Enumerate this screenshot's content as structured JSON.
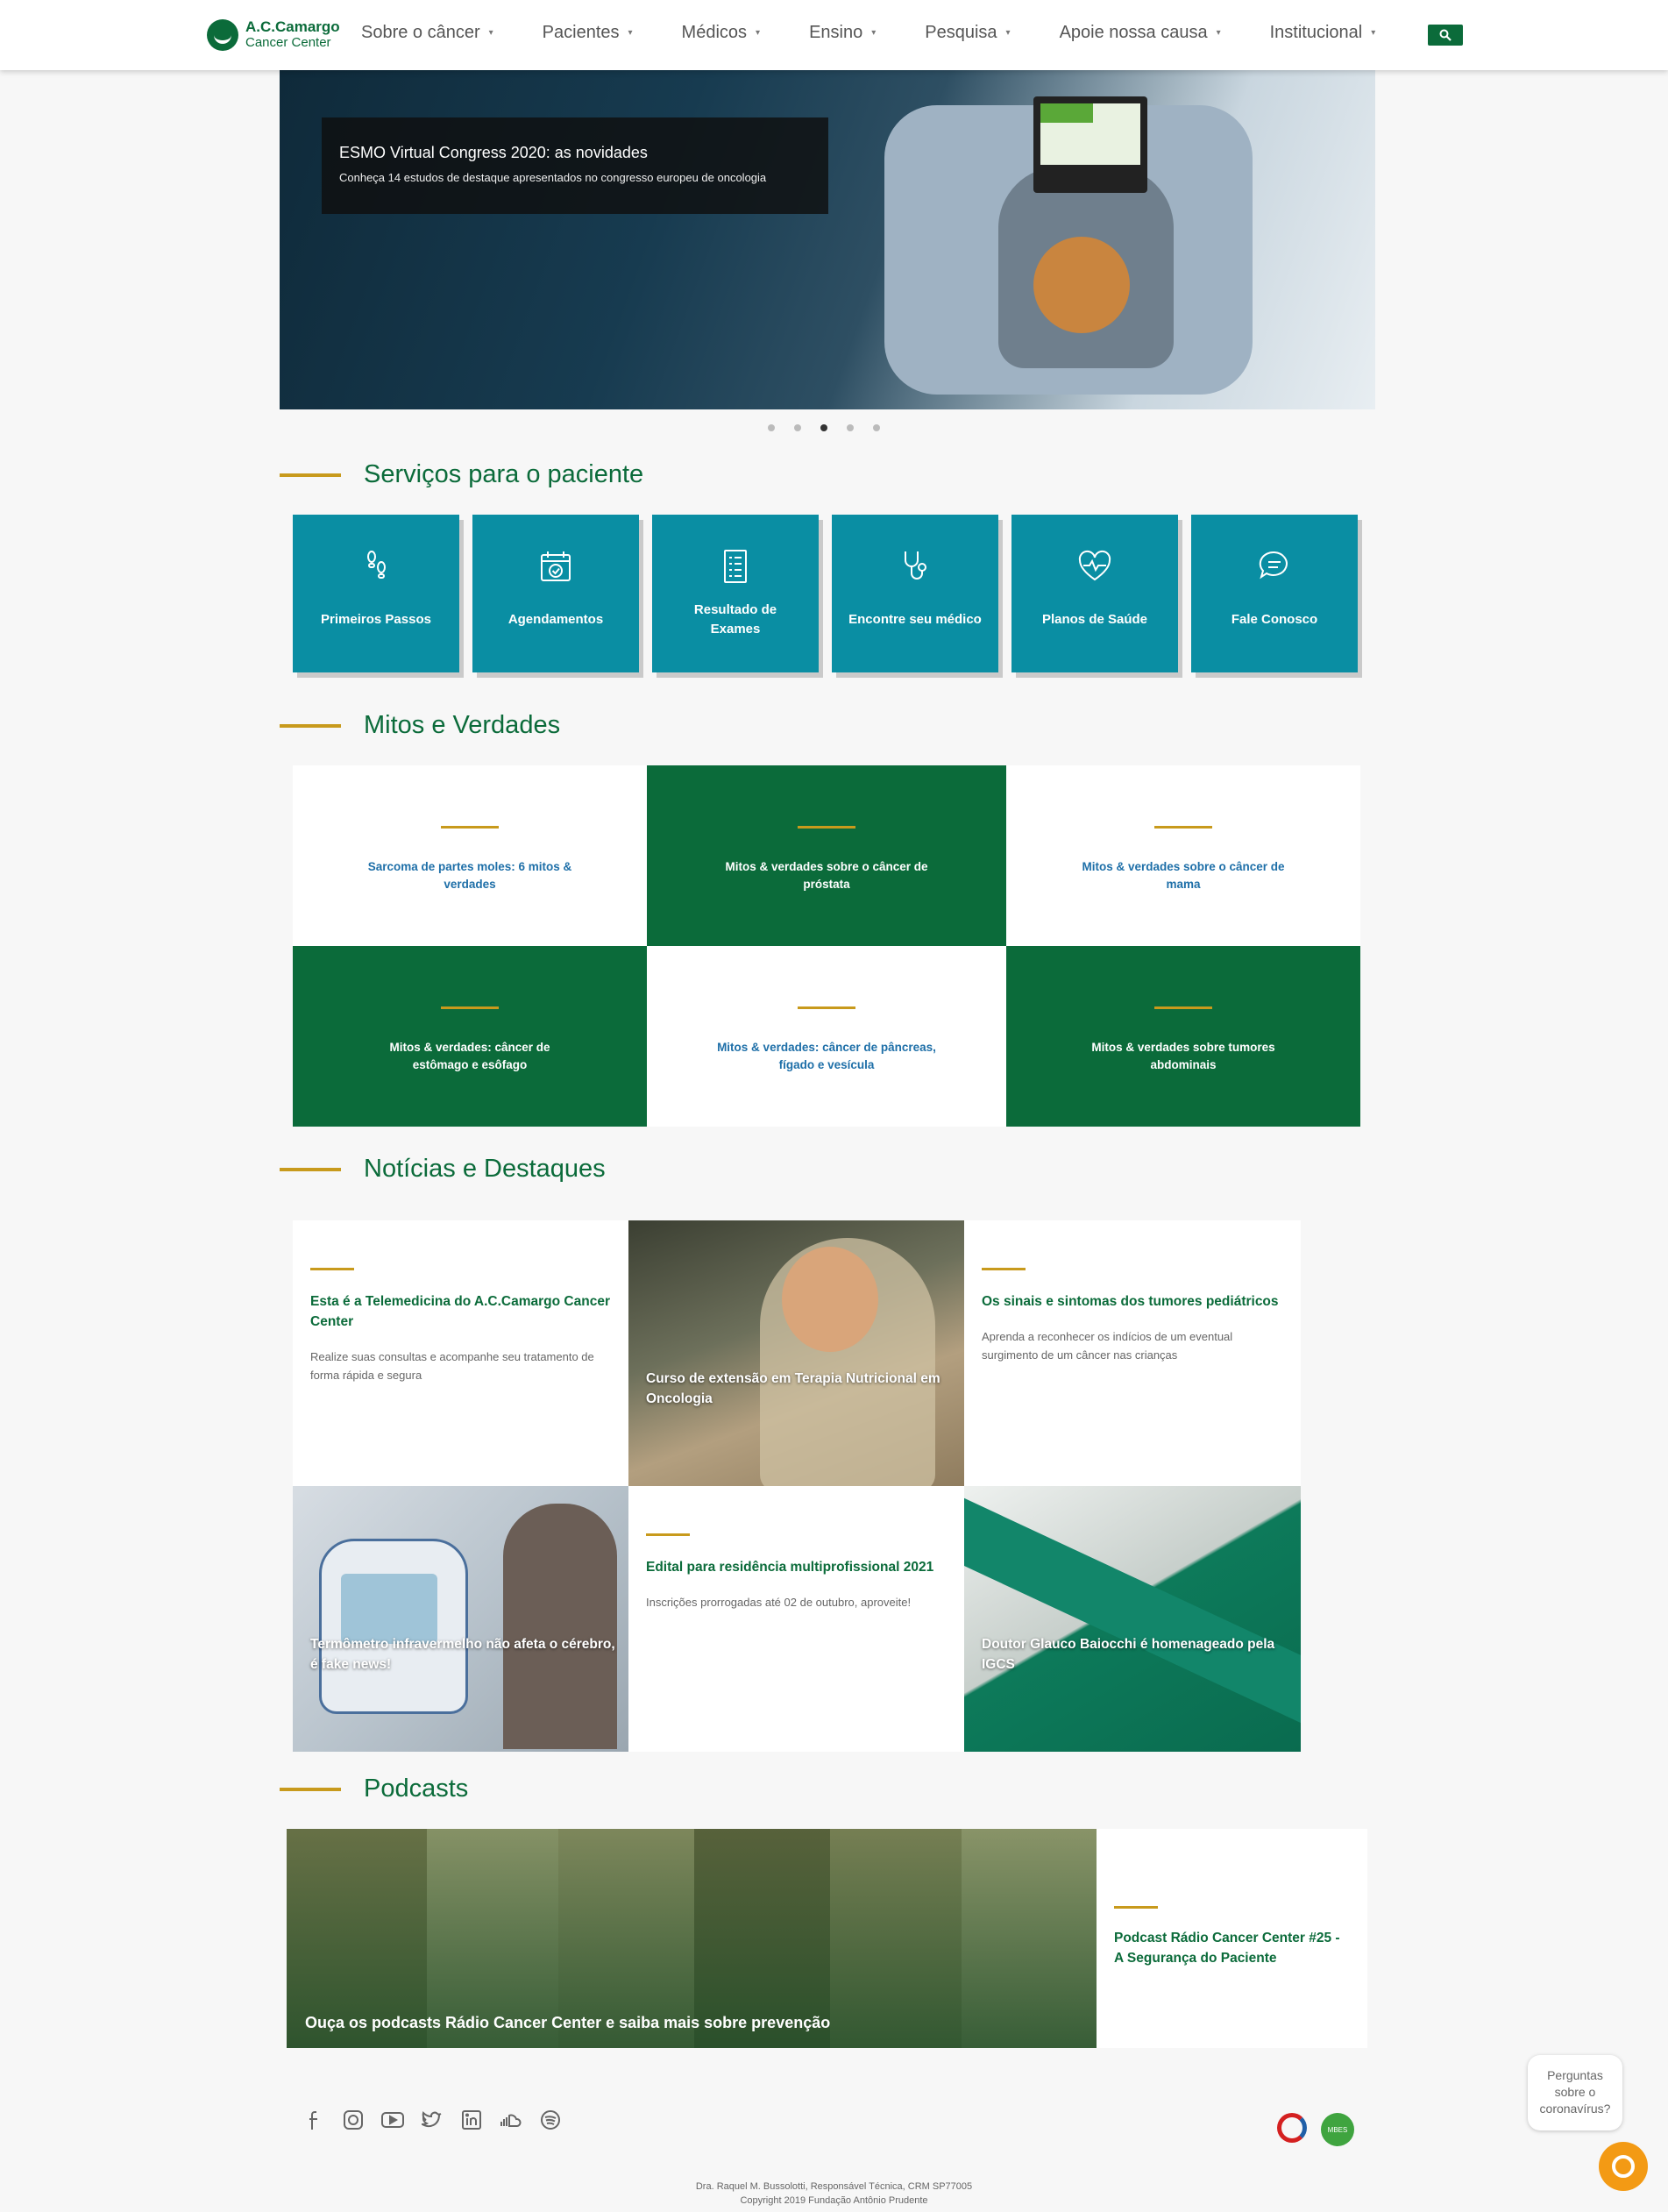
{
  "header": {
    "logo_line1": "A.C.Camargo",
    "logo_line2": "Cancer Center",
    "nav": [
      {
        "label": "Sobre o câncer"
      },
      {
        "label": "Pacientes"
      },
      {
        "label": "Médicos"
      },
      {
        "label": "Ensino"
      },
      {
        "label": "Pesquisa"
      },
      {
        "label": "Apoie nossa causa"
      },
      {
        "label": "Institucional"
      }
    ],
    "search_icon": "search-icon"
  },
  "hero": {
    "title": "ESMO Virtual Congress 2020: as novidades",
    "subtitle": "Conheça 14 estudos de destaque apresentados no congresso europeu de oncologia",
    "slide_count": 5,
    "active_slide": 3
  },
  "sections": {
    "services": "Serviços para o paciente",
    "mitos": "Mitos e Verdades",
    "news": "Notícias e Destaques",
    "podcasts": "Podcasts"
  },
  "services": [
    {
      "label": "Primeiros Passos",
      "icon": "footprints-icon"
    },
    {
      "label": "Agendamentos",
      "icon": "calendar-icon"
    },
    {
      "label": "Resultado de Exames",
      "icon": "checklist-icon"
    },
    {
      "label": "Encontre seu médico",
      "icon": "stethoscope-icon"
    },
    {
      "label": "Planos de Saúde",
      "icon": "heart-pulse-icon"
    },
    {
      "label": "Fale Conosco",
      "icon": "chat-icon"
    }
  ],
  "mitos": [
    {
      "label": "Sarcoma de partes moles: 6 mitos & verdades"
    },
    {
      "label": "Mitos & verdades sobre o câncer de próstata"
    },
    {
      "label": "Mitos & verdades sobre o câncer de mama"
    },
    {
      "label": "Mitos & verdades: câncer de estômago e esôfago"
    },
    {
      "label": "Mitos & verdades: câncer de pâncreas, fígado e vesícula"
    },
    {
      "label": "Mitos & verdades sobre tumores abdominais"
    }
  ],
  "news": [
    {
      "title": "Esta é a Telemedicina do A.C.Camargo Cancer Center",
      "desc": "Realize suas consultas e acompanhe seu tratamento de forma rápida e segura"
    },
    {
      "title": "Curso de extensão em Terapia Nutricional em Oncologia"
    },
    {
      "title": "Os sinais e sintomas dos tumores pediátricos",
      "desc": "Aprenda a reconhecer os indícios de um eventual surgimento de um câncer nas crianças"
    },
    {
      "title": "Termômetro infravermelho não afeta o cérebro, é fake news!"
    },
    {
      "title": "Edital para residência multiprofissional 2021",
      "desc": "Inscrições prorrogadas até 02 de outubro, aproveite!"
    },
    {
      "title": "Doutor Glauco Baiocchi é homenageado pela IGCS"
    }
  ],
  "podcasts": {
    "banner_caption": "Ouça os podcasts Rádio Cancer Center e saiba mais sobre prevenção",
    "card_title": "Podcast Rádio Cancer Center #25 - A Segurança do Paciente"
  },
  "footer": {
    "social": [
      "facebook-icon",
      "instagram-icon",
      "youtube-icon",
      "twitter-icon",
      "linkedin-icon",
      "soundcloud-icon",
      "spotify-icon"
    ],
    "seal_text": "MBES",
    "corona_help": "Perguntas sobre o coronavírus?",
    "credit_line1": "Dra. Raquel M. Bussolotti, Responsável Técnica, CRM SP77005",
    "credit_line2": "Copyright 2019 Fundação Antônio Prudente"
  },
  "colors": {
    "brand_green": "#0b6b3a",
    "service_teal": "#0a8ea3",
    "accent_gold": "#c89a1c",
    "link_blue": "#1e6fa8",
    "chat_orange": "#f39a14"
  }
}
